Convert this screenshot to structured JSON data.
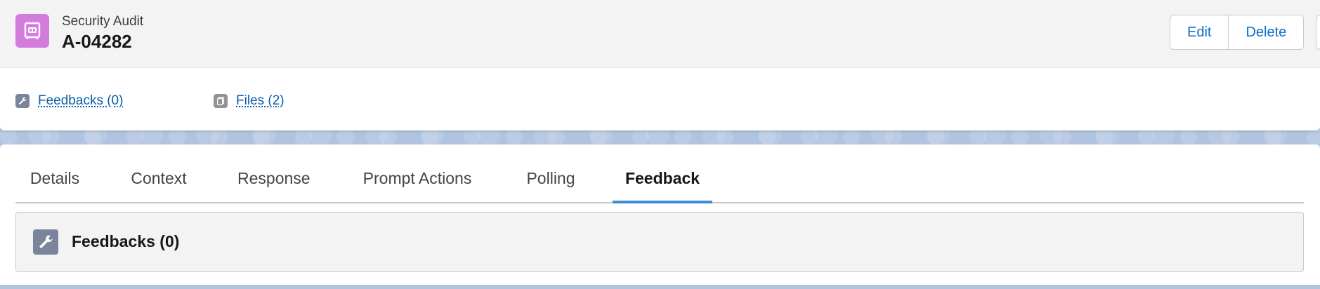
{
  "record": {
    "object_name": "Security Audit",
    "title": "A-04282",
    "icon": "audit-record-icon"
  },
  "actions": {
    "edit_label": "Edit",
    "delete_label": "Delete"
  },
  "related": {
    "feedbacks_label": "Feedbacks (0)",
    "feedbacks_icon": "wrench-icon",
    "files_label": "Files (2)",
    "files_icon": "files-icon"
  },
  "tabs": [
    {
      "label": "Details"
    },
    {
      "label": "Context"
    },
    {
      "label": "Response"
    },
    {
      "label": "Prompt Actions"
    },
    {
      "label": "Polling"
    },
    {
      "label": "Feedback",
      "active": true
    }
  ],
  "feedback_card": {
    "title": "Feedbacks (0)",
    "icon": "wrench-icon"
  },
  "colors": {
    "record_icon": "#d37cde",
    "link": "#0b5cab",
    "active_tab_indicator": "#3b8bd9",
    "page_background": "#b0c4df"
  }
}
